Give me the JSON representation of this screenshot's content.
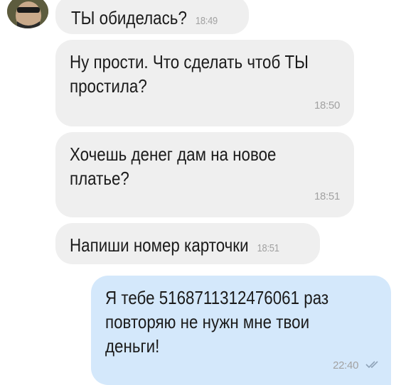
{
  "chat": {
    "messages": [
      {
        "direction": "incoming",
        "text": "ТЫ обиделась?",
        "time": "18:49"
      },
      {
        "direction": "incoming",
        "text_lines": [
          "Ну прости. Что сделать чтоб ТЫ",
          "простила?"
        ],
        "time": "18:50"
      },
      {
        "direction": "incoming",
        "text_lines": [
          "Хочешь денег дам на новое",
          "платье?"
        ],
        "time": "18:51"
      },
      {
        "direction": "incoming",
        "text": "Напиши номер карточки",
        "time": "18:51"
      },
      {
        "direction": "outgoing",
        "text_lines": [
          "Я тебе 5168711312476061 раз",
          "повторяю не нужн мне твои",
          "деньги!"
        ],
        "time": "22:40",
        "status_icon": "double-check-icon"
      }
    ]
  },
  "colors": {
    "incoming_bubble": "#efefef",
    "outgoing_bubble": "#d4e8fb",
    "timestamp": "#a2a2a2",
    "check": "#8fa3b8"
  }
}
